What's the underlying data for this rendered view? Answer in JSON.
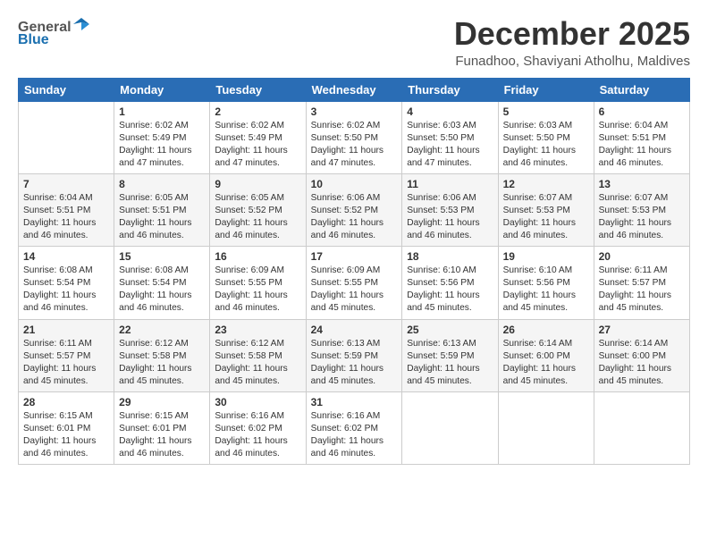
{
  "logo": {
    "general": "General",
    "blue": "Blue"
  },
  "title": {
    "month_year": "December 2025",
    "location": "Funadhoo, Shaviyani Atholhu, Maldives"
  },
  "calendar": {
    "headers": [
      "Sunday",
      "Monday",
      "Tuesday",
      "Wednesday",
      "Thursday",
      "Friday",
      "Saturday"
    ],
    "weeks": [
      [
        {
          "day": "",
          "content": ""
        },
        {
          "day": "1",
          "content": "Sunrise: 6:02 AM\nSunset: 5:49 PM\nDaylight: 11 hours\nand 47 minutes."
        },
        {
          "day": "2",
          "content": "Sunrise: 6:02 AM\nSunset: 5:49 PM\nDaylight: 11 hours\nand 47 minutes."
        },
        {
          "day": "3",
          "content": "Sunrise: 6:02 AM\nSunset: 5:50 PM\nDaylight: 11 hours\nand 47 minutes."
        },
        {
          "day": "4",
          "content": "Sunrise: 6:03 AM\nSunset: 5:50 PM\nDaylight: 11 hours\nand 47 minutes."
        },
        {
          "day": "5",
          "content": "Sunrise: 6:03 AM\nSunset: 5:50 PM\nDaylight: 11 hours\nand 46 minutes."
        },
        {
          "day": "6",
          "content": "Sunrise: 6:04 AM\nSunset: 5:51 PM\nDaylight: 11 hours\nand 46 minutes."
        }
      ],
      [
        {
          "day": "7",
          "content": "Sunrise: 6:04 AM\nSunset: 5:51 PM\nDaylight: 11 hours\nand 46 minutes."
        },
        {
          "day": "8",
          "content": "Sunrise: 6:05 AM\nSunset: 5:51 PM\nDaylight: 11 hours\nand 46 minutes."
        },
        {
          "day": "9",
          "content": "Sunrise: 6:05 AM\nSunset: 5:52 PM\nDaylight: 11 hours\nand 46 minutes."
        },
        {
          "day": "10",
          "content": "Sunrise: 6:06 AM\nSunset: 5:52 PM\nDaylight: 11 hours\nand 46 minutes."
        },
        {
          "day": "11",
          "content": "Sunrise: 6:06 AM\nSunset: 5:53 PM\nDaylight: 11 hours\nand 46 minutes."
        },
        {
          "day": "12",
          "content": "Sunrise: 6:07 AM\nSunset: 5:53 PM\nDaylight: 11 hours\nand 46 minutes."
        },
        {
          "day": "13",
          "content": "Sunrise: 6:07 AM\nSunset: 5:53 PM\nDaylight: 11 hours\nand 46 minutes."
        }
      ],
      [
        {
          "day": "14",
          "content": "Sunrise: 6:08 AM\nSunset: 5:54 PM\nDaylight: 11 hours\nand 46 minutes."
        },
        {
          "day": "15",
          "content": "Sunrise: 6:08 AM\nSunset: 5:54 PM\nDaylight: 11 hours\nand 46 minutes."
        },
        {
          "day": "16",
          "content": "Sunrise: 6:09 AM\nSunset: 5:55 PM\nDaylight: 11 hours\nand 46 minutes."
        },
        {
          "day": "17",
          "content": "Sunrise: 6:09 AM\nSunset: 5:55 PM\nDaylight: 11 hours\nand 45 minutes."
        },
        {
          "day": "18",
          "content": "Sunrise: 6:10 AM\nSunset: 5:56 PM\nDaylight: 11 hours\nand 45 minutes."
        },
        {
          "day": "19",
          "content": "Sunrise: 6:10 AM\nSunset: 5:56 PM\nDaylight: 11 hours\nand 45 minutes."
        },
        {
          "day": "20",
          "content": "Sunrise: 6:11 AM\nSunset: 5:57 PM\nDaylight: 11 hours\nand 45 minutes."
        }
      ],
      [
        {
          "day": "21",
          "content": "Sunrise: 6:11 AM\nSunset: 5:57 PM\nDaylight: 11 hours\nand 45 minutes."
        },
        {
          "day": "22",
          "content": "Sunrise: 6:12 AM\nSunset: 5:58 PM\nDaylight: 11 hours\nand 45 minutes."
        },
        {
          "day": "23",
          "content": "Sunrise: 6:12 AM\nSunset: 5:58 PM\nDaylight: 11 hours\nand 45 minutes."
        },
        {
          "day": "24",
          "content": "Sunrise: 6:13 AM\nSunset: 5:59 PM\nDaylight: 11 hours\nand 45 minutes."
        },
        {
          "day": "25",
          "content": "Sunrise: 6:13 AM\nSunset: 5:59 PM\nDaylight: 11 hours\nand 45 minutes."
        },
        {
          "day": "26",
          "content": "Sunrise: 6:14 AM\nSunset: 6:00 PM\nDaylight: 11 hours\nand 45 minutes."
        },
        {
          "day": "27",
          "content": "Sunrise: 6:14 AM\nSunset: 6:00 PM\nDaylight: 11 hours\nand 45 minutes."
        }
      ],
      [
        {
          "day": "28",
          "content": "Sunrise: 6:15 AM\nSunset: 6:01 PM\nDaylight: 11 hours\nand 46 minutes."
        },
        {
          "day": "29",
          "content": "Sunrise: 6:15 AM\nSunset: 6:01 PM\nDaylight: 11 hours\nand 46 minutes."
        },
        {
          "day": "30",
          "content": "Sunrise: 6:16 AM\nSunset: 6:02 PM\nDaylight: 11 hours\nand 46 minutes."
        },
        {
          "day": "31",
          "content": "Sunrise: 6:16 AM\nSunset: 6:02 PM\nDaylight: 11 hours\nand 46 minutes."
        },
        {
          "day": "",
          "content": ""
        },
        {
          "day": "",
          "content": ""
        },
        {
          "day": "",
          "content": ""
        }
      ]
    ]
  }
}
